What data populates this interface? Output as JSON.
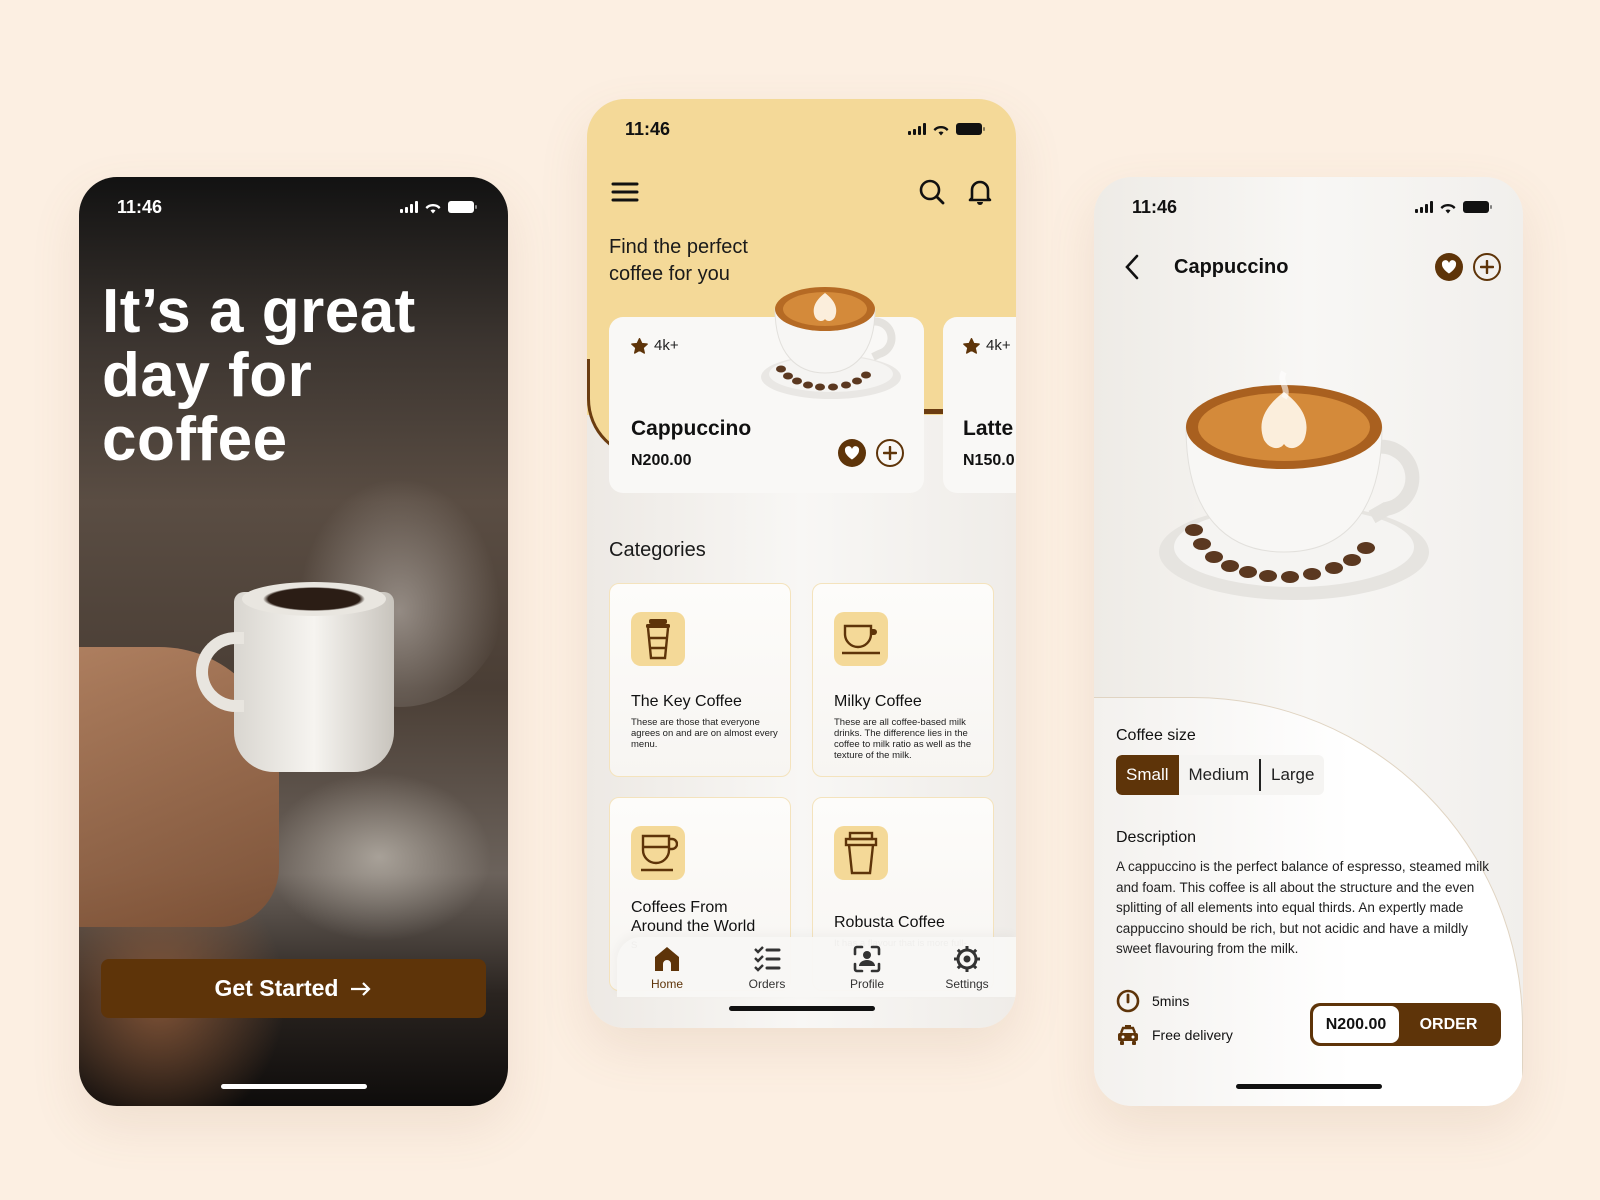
{
  "colors": {
    "brand_brown": "#5e3409",
    "header_yellow": "#f4d998",
    "background": "#fcefe2"
  },
  "screens": {
    "welcome": {
      "status_time": "11:46",
      "headline": "It’s a great day for coffee",
      "headline_lines": [
        "It’s a great",
        "day for",
        "coffee"
      ],
      "cta_label": "Get Started",
      "cta_icon": "arrow-right-icon"
    },
    "home": {
      "status_time": "11:46",
      "tagline_lines": [
        "Find the perfect",
        "coffee for you"
      ],
      "products": [
        {
          "name": "Cappuccino",
          "price": "N200.00",
          "rating": "4k+"
        },
        {
          "name": "Latte",
          "price": "N150.0",
          "rating": "4k+"
        }
      ],
      "categories_title": "Categories",
      "categories": [
        {
          "title": "The Key Coffee",
          "description": "These are those that everyone agrees on and are on almost every menu.",
          "icon": "takeaway-cup-icon"
        },
        {
          "title": "Milky Coffee",
          "description": "These are all coffee-based milk drinks. The difference lies in the coffee to milk ratio as well as the texture of the milk.",
          "icon": "cup-saucer-icon"
        },
        {
          "title": "Coffees From Around the World",
          "description": "S",
          "icon": "mug-icon"
        },
        {
          "title": "Robusta Coffee",
          "description": "It has a flavour that is more full-",
          "icon": "paper-cup-icon"
        }
      ],
      "nav": [
        {
          "label": "Home",
          "icon": "home-icon",
          "active": true
        },
        {
          "label": "Orders",
          "icon": "checklist-icon",
          "active": false
        },
        {
          "label": "Profile",
          "icon": "profile-scan-icon",
          "active": false
        },
        {
          "label": "Settings",
          "icon": "gear-icon",
          "active": false
        }
      ]
    },
    "detail": {
      "status_time": "11:46",
      "title": "Cappuccino",
      "size_label": "Coffee size",
      "sizes": [
        "Small",
        "Medium",
        "Large"
      ],
      "selected_size": "Small",
      "description_label": "Description",
      "description": "A cappuccino is the perfect balance of espresso, steamed milk and foam. This coffee is all about the structure and the even splitting of all elements into equal thirds. An expertly made cappuccino should be rich, but not acidic and have a mildly sweet flavouring from the milk.",
      "prep_time": "5mins",
      "delivery": "Free delivery",
      "price": "N200.00",
      "order_label": "ORDER"
    }
  }
}
